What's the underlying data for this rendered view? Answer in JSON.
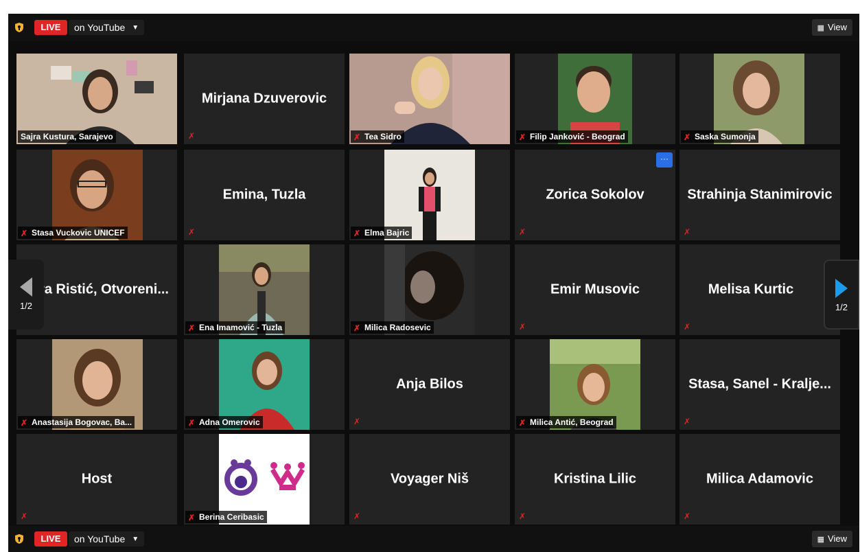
{
  "top_bar": {
    "live": "LIVE",
    "stream_target": "on YouTube",
    "view": "View"
  },
  "bottom_bar": {
    "live": "LIVE",
    "stream_target": "on YouTube",
    "view": "View"
  },
  "pagination": {
    "left": "1/2",
    "right": "1/2"
  },
  "participants": [
    {
      "name": "Sajra Kustura, Sarajevo",
      "video": true
    },
    {
      "name": "Mirjana Dzuverovic",
      "video": false
    },
    {
      "name": "Tea Sidro",
      "video": true
    },
    {
      "name": "Filip Janković - Beograd",
      "video": true
    },
    {
      "name": "Saska Sumonja",
      "video": true
    },
    {
      "name": "Stasa Vuckovic UNICEF",
      "video": true
    },
    {
      "name": "Emina, Tuzla",
      "video": false
    },
    {
      "name": "Elma Bajric",
      "video": true
    },
    {
      "name": "Zorica Sokolov",
      "video": false
    },
    {
      "name": "Strahinja Stanimirovic",
      "video": false
    },
    {
      "name": "ra Ristić, Otvoreni...",
      "video": false
    },
    {
      "name": "Ena Imamović - Tuzla",
      "video": true
    },
    {
      "name": "Milica Radosevic",
      "video": true
    },
    {
      "name": "Emir Musovic",
      "video": false
    },
    {
      "name": "Melisa Kurtic",
      "video": false
    },
    {
      "name": "Anastasija Bogovac, Ba...",
      "video": true
    },
    {
      "name": "Adna Omerovic",
      "video": true
    },
    {
      "name": "Anja Bilos",
      "video": false
    },
    {
      "name": "Milica Antić, Beograd",
      "video": true
    },
    {
      "name": "Stasa, Sanel - Kralje...",
      "video": false
    },
    {
      "name": "Host",
      "video": false
    },
    {
      "name": "Berina Ceribasic",
      "video": true
    },
    {
      "name": "Voyager Niš",
      "video": false
    },
    {
      "name": "Kristina Lilic",
      "video": false
    },
    {
      "name": "Milica Adamovic",
      "video": false
    }
  ],
  "tile_more": "···",
  "colors": {
    "live": "#e02525",
    "active_speaker": "#b8e04a",
    "muted": "#e02525",
    "next_arrow": "#1e9be8"
  }
}
